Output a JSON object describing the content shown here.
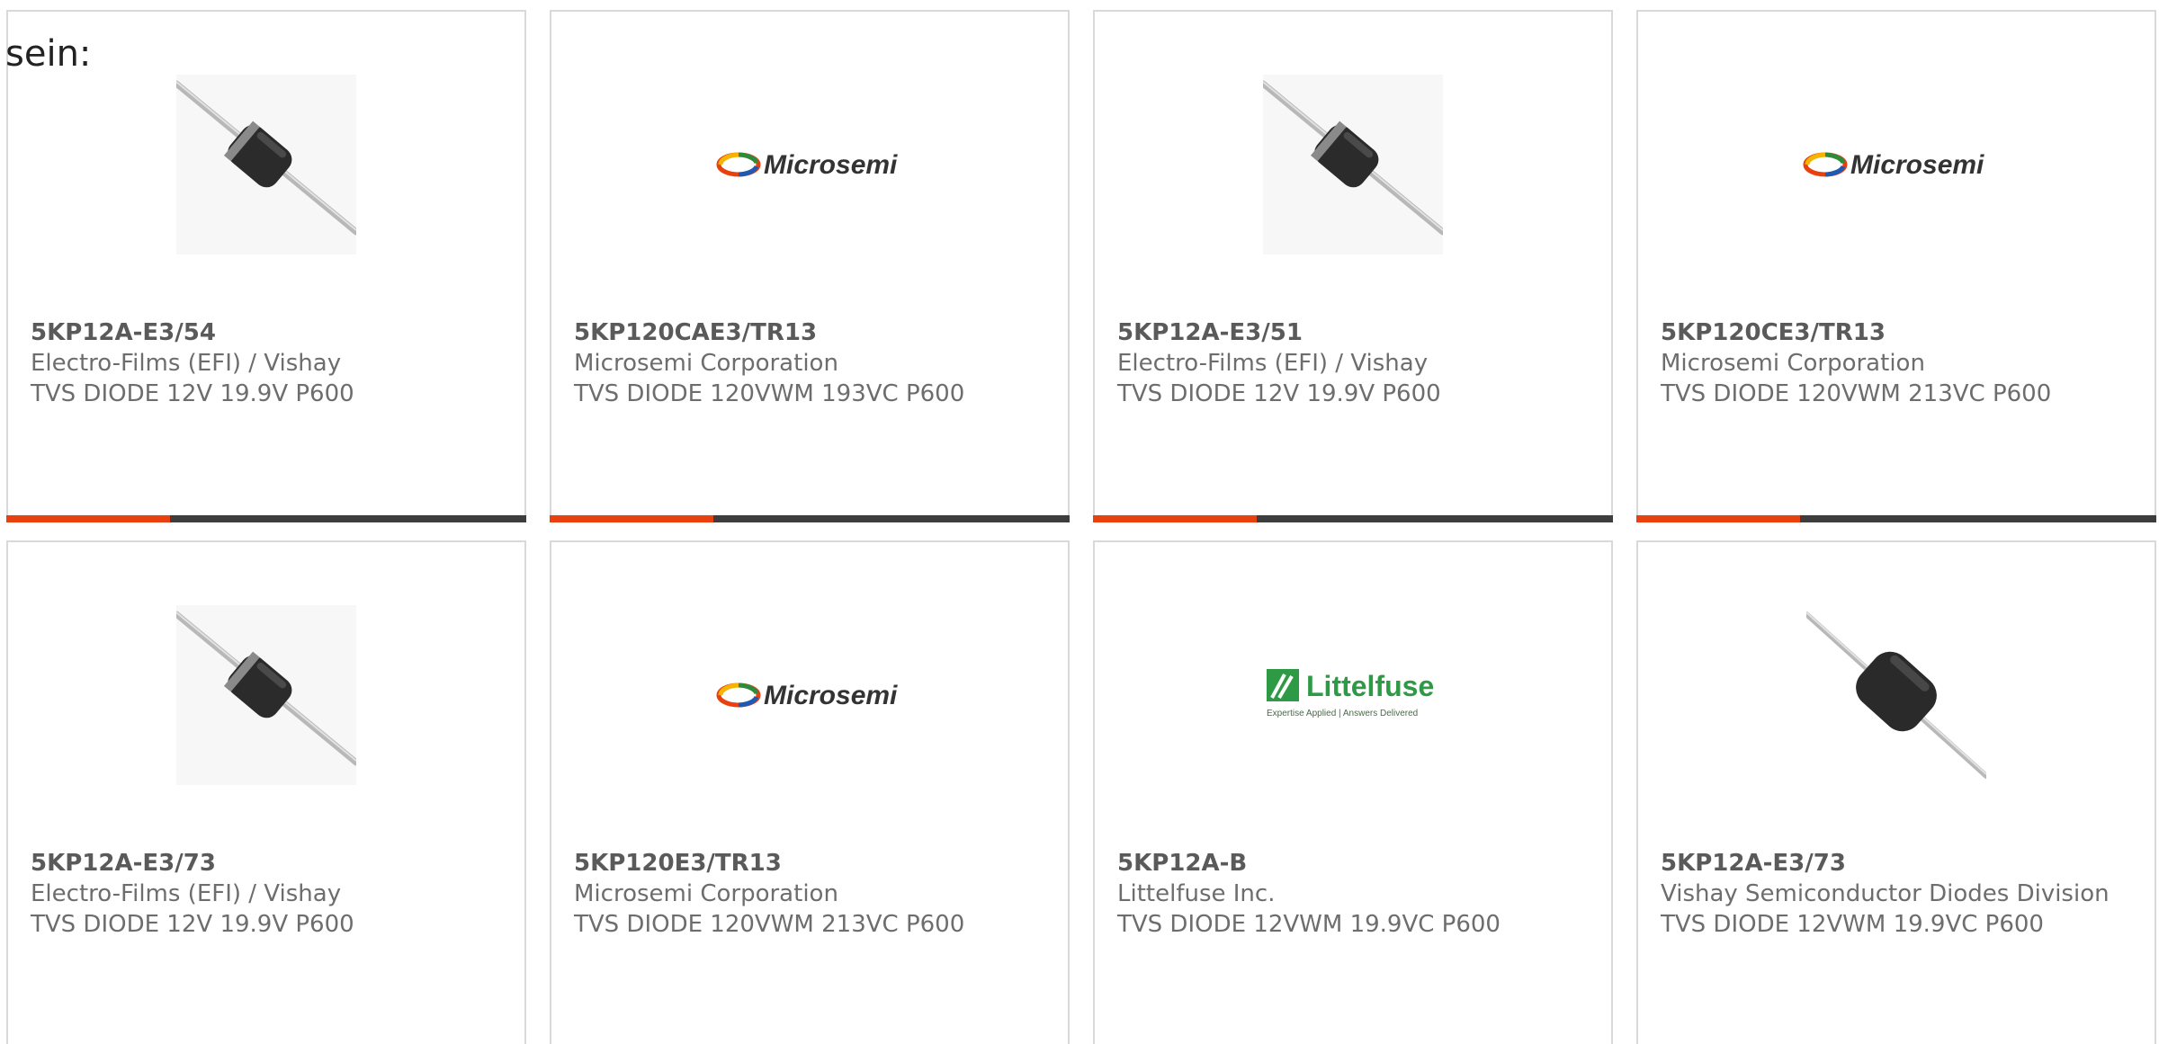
{
  "lead_text": "sein:",
  "colors": {
    "accent": "#e8410f",
    "bar_dark": "#3d3d3d",
    "card_border": "#d9d9d9",
    "text": "#6d6d6d",
    "part_number": "#5a5a5a"
  },
  "products": [
    {
      "part_number": "5KP12A-E3/54",
      "manufacturer": "Electro-Films (EFI) / Vishay",
      "description": "TVS DIODE 12V 19.9V P600",
      "image": "axial-diode-banded"
    },
    {
      "part_number": "5KP120CAE3/TR13",
      "manufacturer": "Microsemi Corporation",
      "description": "TVS DIODE 120VWM 193VC P600",
      "image": "microsemi-logo",
      "logo_text": "Microsemi"
    },
    {
      "part_number": "5KP12A-E3/51",
      "manufacturer": "Electro-Films (EFI) / Vishay",
      "description": "TVS DIODE 12V 19.9V P600",
      "image": "axial-diode-banded"
    },
    {
      "part_number": "5KP120CE3/TR13",
      "manufacturer": "Microsemi Corporation",
      "description": "TVS DIODE 120VWM 213VC P600",
      "image": "microsemi-logo",
      "logo_text": "Microsemi"
    },
    {
      "part_number": "5KP12A-E3/73",
      "manufacturer": "Electro-Films (EFI) / Vishay",
      "description": "TVS DIODE 12V 19.9V P600",
      "image": "axial-diode-banded"
    },
    {
      "part_number": "5KP120E3/TR13",
      "manufacturer": "Microsemi Corporation",
      "description": "TVS DIODE 120VWM 213VC P600",
      "image": "microsemi-logo",
      "logo_text": "Microsemi"
    },
    {
      "part_number": "5KP12A-B",
      "manufacturer": "Littelfuse Inc.",
      "description": "TVS DIODE 12VWM 19.9VC P600",
      "image": "littelfuse-logo",
      "logo_text": "Littelfuse",
      "logo_tagline": "Expertise Applied | Answers Delivered"
    },
    {
      "part_number": "5KP12A-E3/73",
      "manufacturer": "Vishay Semiconductor Diodes Division",
      "description": "TVS DIODE 12VWM 19.9VC P600",
      "image": "axial-diode"
    }
  ]
}
